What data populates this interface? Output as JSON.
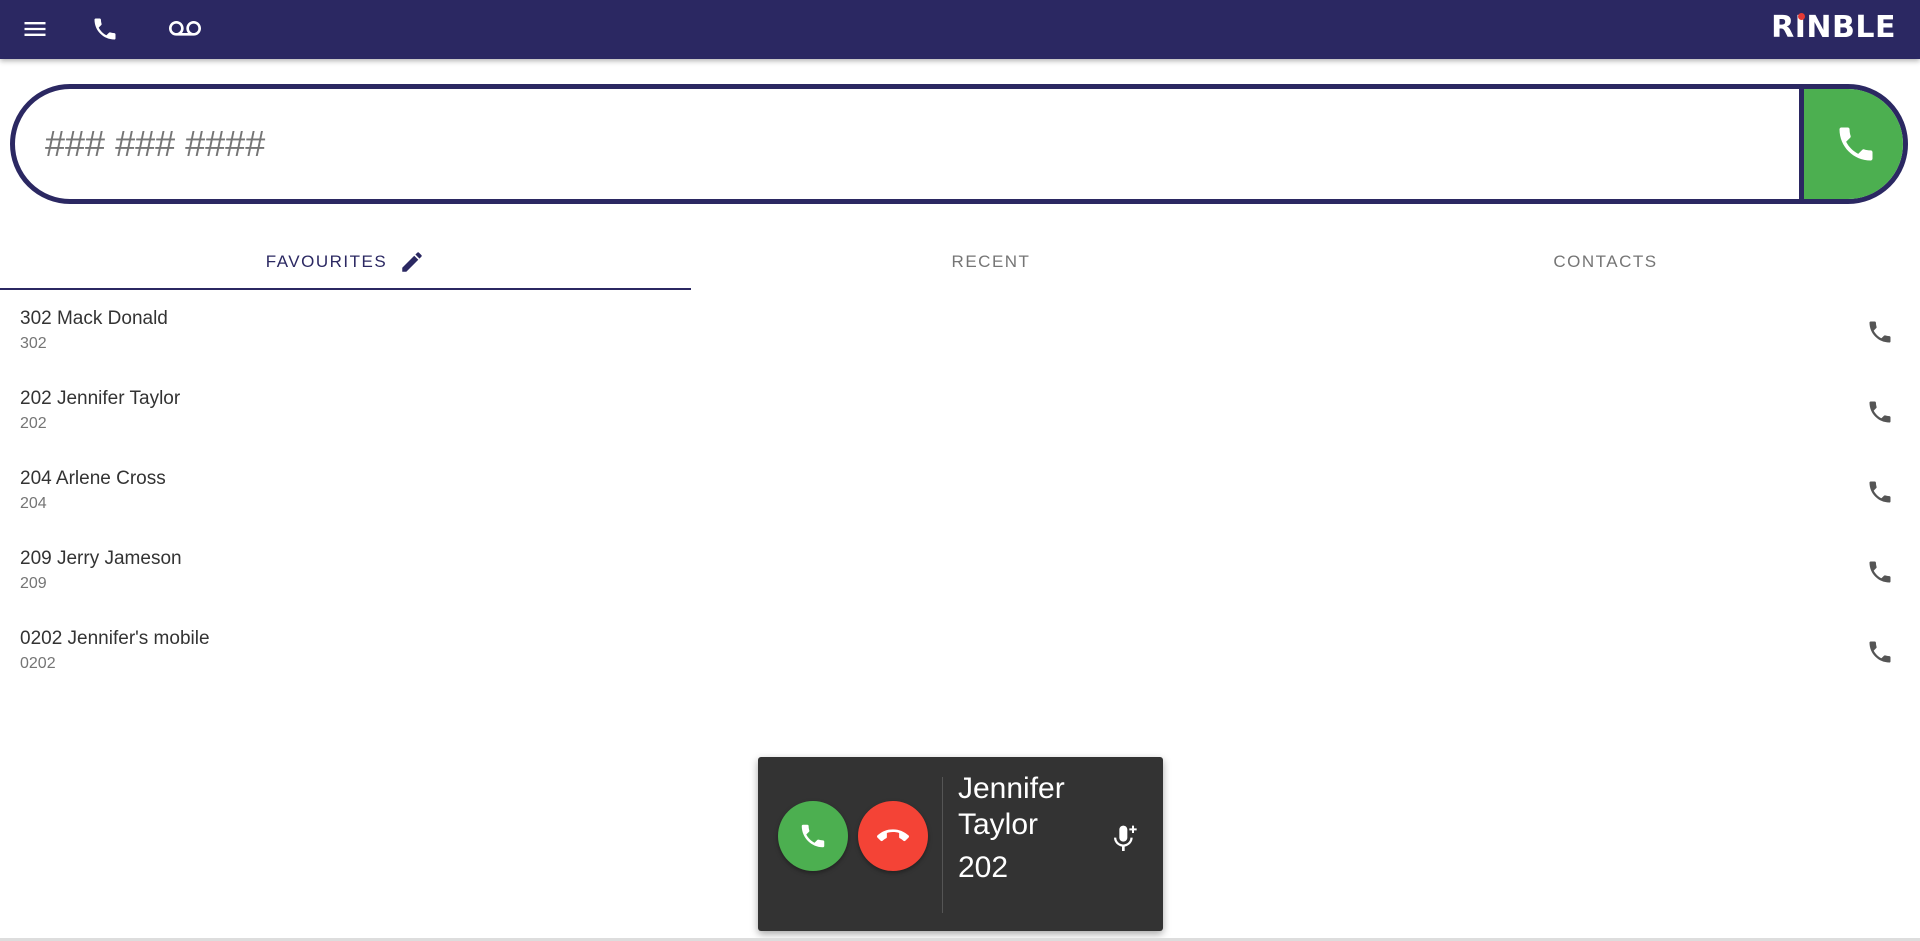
{
  "app": {
    "logo_text_pre": "R",
    "logo_text_i": "I",
    "logo_text_post": "NBLE"
  },
  "topbar": {
    "icons": [
      "menu-icon",
      "phone-icon",
      "voicemail-icon"
    ]
  },
  "dialer": {
    "placeholder": "### ### ####",
    "value": ""
  },
  "tabs": [
    {
      "label": "FAVOURITES",
      "active": true
    },
    {
      "label": "RECENT",
      "active": false
    },
    {
      "label": "CONTACTS",
      "active": false
    }
  ],
  "favourites": [
    {
      "name": "302 Mack Donald",
      "number": "302"
    },
    {
      "name": "202 Jennifer Taylor",
      "number": "202"
    },
    {
      "name": "204 Arlene Cross",
      "number": "204"
    },
    {
      "name": "209 Jerry Jameson",
      "number": "209"
    },
    {
      "name": "0202 Jennifer's mobile",
      "number": "0202"
    }
  ],
  "incoming_call": {
    "caller_name": "Jennifer Taylor",
    "caller_number": "202"
  },
  "colors": {
    "primary": "#2b2862",
    "answer": "#4caf50",
    "decline": "#f44336",
    "popup_bg": "#333333",
    "logo_dot": "#e53935"
  }
}
